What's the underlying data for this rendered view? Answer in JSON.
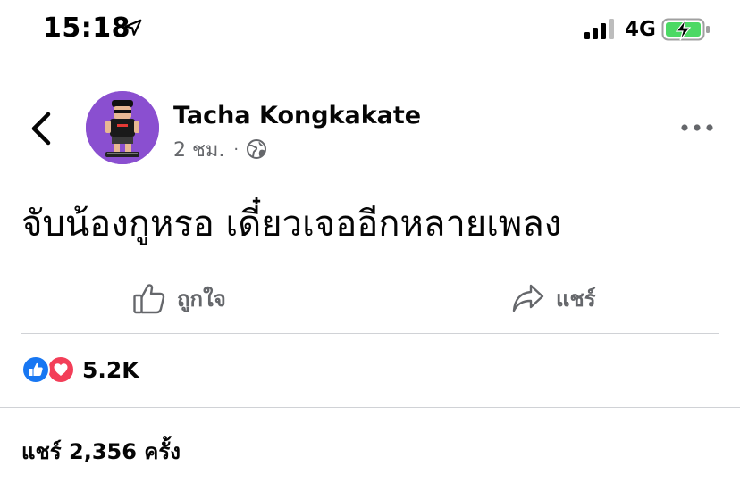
{
  "status_bar": {
    "time": "15:18",
    "network": "4G",
    "icons": [
      "location-arrow-icon",
      "cellular-signal-icon",
      "battery-charging-icon"
    ],
    "battery_color": "#4cd964"
  },
  "post": {
    "author": "Tacha Kongkakate",
    "time_ago": "2 ชม.",
    "separator": "·",
    "privacy_icon": "globe-icon",
    "text": "จับน้องกูหรอ เดี๋ยวเจออีกหลายเพลง",
    "avatar_bg": "#8a4fd0"
  },
  "actions": {
    "like_label": "ถูกใจ",
    "share_label": "แชร์"
  },
  "reactions": {
    "count": "5.2K",
    "like_color": "#1877f2",
    "love_color": "#f33e58"
  },
  "shares": {
    "text": "แชร์ 2,356 ครั้ง"
  }
}
